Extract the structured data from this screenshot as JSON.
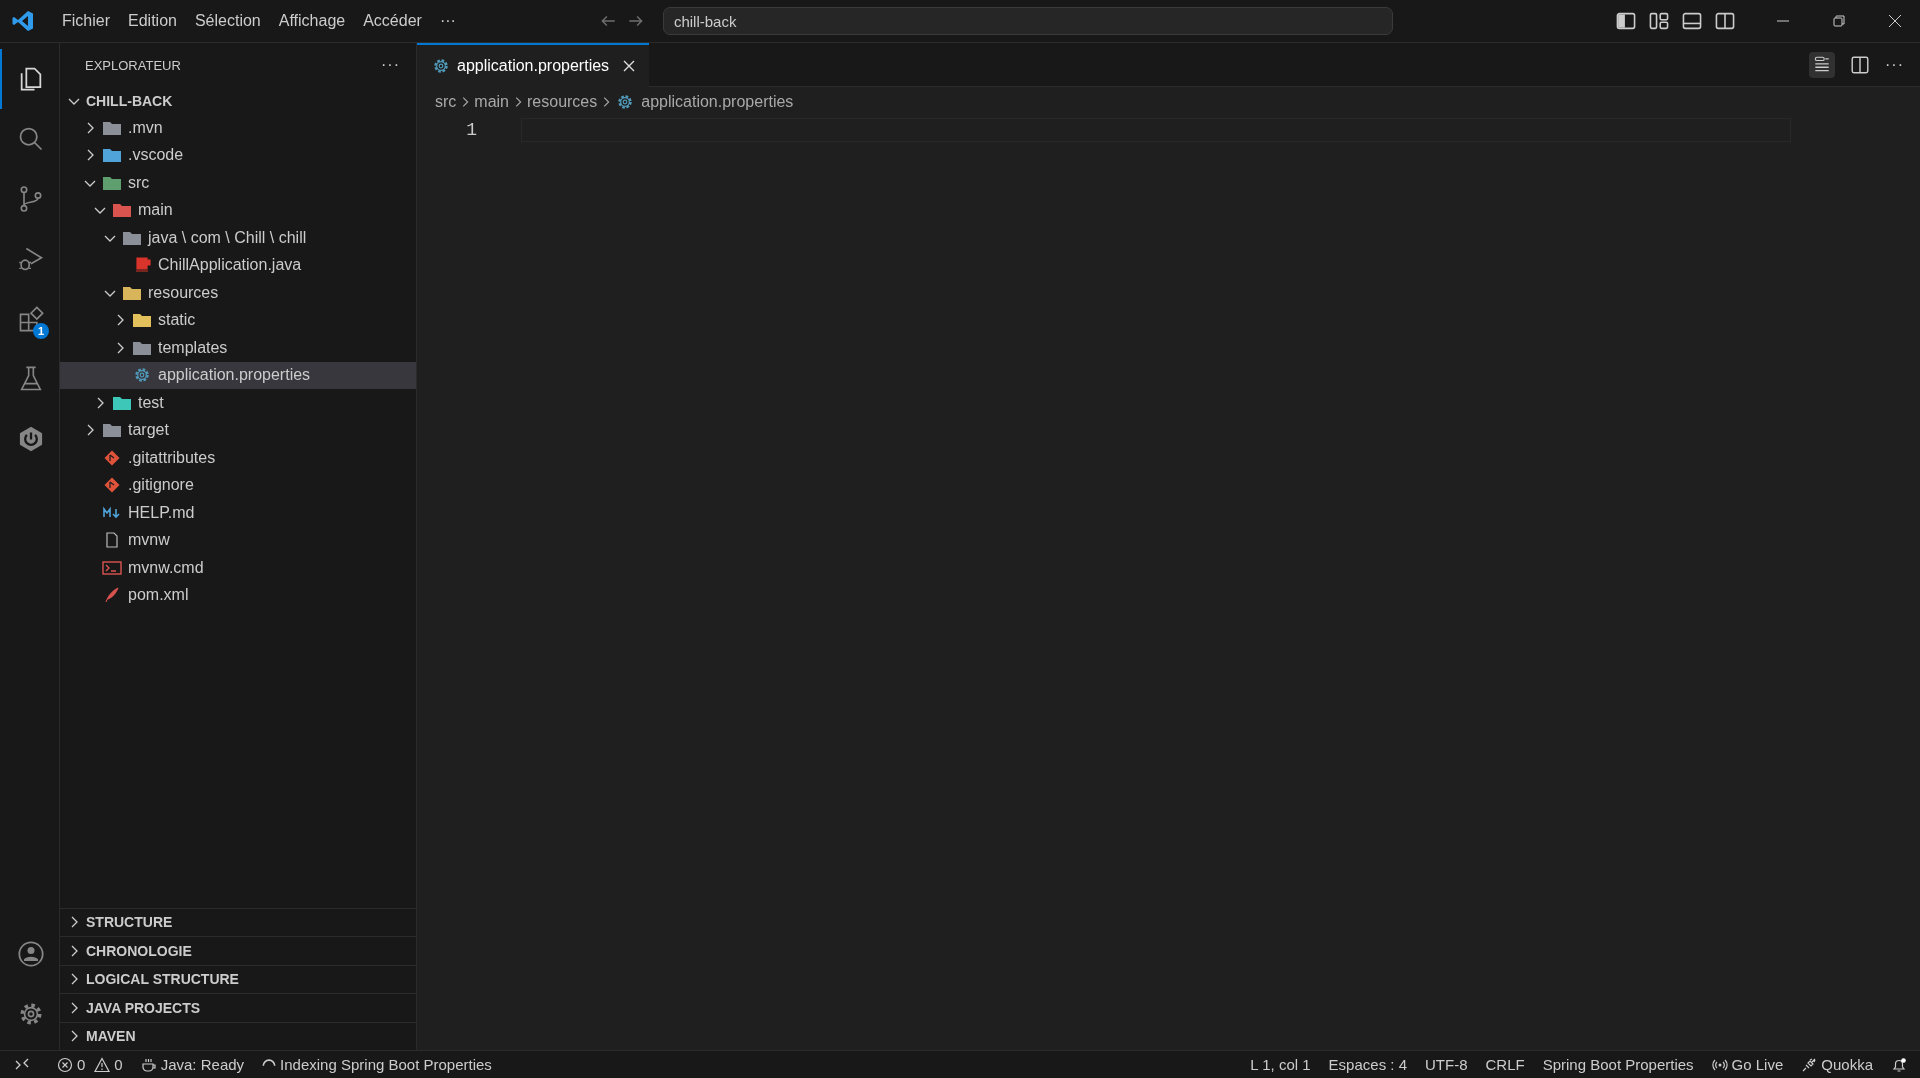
{
  "menu": [
    {
      "label": "Fichier"
    },
    {
      "label": "Edition"
    },
    {
      "label": "Sélection"
    },
    {
      "label": "Affichage"
    },
    {
      "label": "Accéder"
    },
    {
      "label": "···"
    }
  ],
  "search": {
    "value": "chill-back"
  },
  "activity_bar": {
    "items": [
      {
        "kind": "explorer",
        "selected": true
      },
      {
        "kind": "search",
        "selected": false
      },
      {
        "kind": "source-control",
        "selected": false
      },
      {
        "kind": "run-debug",
        "selected": false
      },
      {
        "kind": "extensions",
        "selected": false,
        "badge": "1"
      },
      {
        "kind": "testing",
        "selected": false
      },
      {
        "kind": "spring-boot",
        "selected": false
      }
    ],
    "bottom": [
      {
        "kind": "account"
      },
      {
        "kind": "settings"
      }
    ]
  },
  "sidebar": {
    "title": "EXPLORATEUR",
    "more": "···",
    "root": {
      "label": "CHILL-BACK",
      "expanded": true
    },
    "tree": [
      {
        "label": ".mvn",
        "kind": "folder-mvn",
        "expanded": false,
        "selected": false
      },
      {
        "label": ".vscode",
        "kind": "folder-vscode",
        "expanded": false,
        "selected": false
      },
      {
        "label": "src",
        "kind": "folder-src",
        "expanded": true,
        "selected": false,
        "children": [
          {
            "label": "main",
            "kind": "folder-main",
            "expanded": true,
            "selected": false,
            "children": [
              {
                "label": "java \\ com \\ Chill \\ chill",
                "kind": "folder-package",
                "expanded": true,
                "selected": false,
                "children": [
                  {
                    "label": "ChillApplication.java",
                    "kind": "java",
                    "selected": false
                  }
                ]
              },
              {
                "label": "resources",
                "kind": "folder-resources",
                "expanded": true,
                "selected": false,
                "children": [
                  {
                    "label": "static",
                    "kind": "folder-static",
                    "expanded": false,
                    "selected": false
                  },
                  {
                    "label": "templates",
                    "kind": "folder-templates",
                    "expanded": false,
                    "selected": false
                  },
                  {
                    "label": "application.properties",
                    "kind": "properties",
                    "selected": true
                  }
                ]
              }
            ]
          },
          {
            "label": "test",
            "kind": "folder-test",
            "expanded": false,
            "selected": false
          }
        ]
      },
      {
        "label": "target",
        "kind": "folder-target",
        "expanded": false,
        "selected": false
      },
      {
        "label": ".gitattributes",
        "kind": "git",
        "selected": false
      },
      {
        "label": ".gitignore",
        "kind": "git",
        "selected": false
      },
      {
        "label": "HELP.md",
        "kind": "markdown",
        "selected": false
      },
      {
        "label": "mvnw",
        "kind": "file",
        "selected": false
      },
      {
        "label": "mvnw.cmd",
        "kind": "cmd",
        "selected": false
      },
      {
        "label": "pom.xml",
        "kind": "xml",
        "selected": false
      }
    ],
    "panels": [
      {
        "label": "STRUCTURE",
        "expanded": false
      },
      {
        "label": "CHRONOLOGIE",
        "expanded": false
      },
      {
        "label": "LOGICAL STRUCTURE",
        "expanded": false
      },
      {
        "label": "JAVA PROJECTS",
        "expanded": false
      },
      {
        "label": "MAVEN",
        "expanded": false
      }
    ]
  },
  "editor": {
    "tabs": [
      {
        "label": "application.properties",
        "selected": true
      }
    ],
    "more": "···",
    "breadcrumbs": [
      {
        "label": "src",
        "kind": "plain"
      },
      {
        "label": "main",
        "kind": "plain"
      },
      {
        "label": "resources",
        "kind": "plain"
      },
      {
        "label": "application.properties",
        "kind": "properties"
      }
    ],
    "lines": [
      {
        "number": "1"
      }
    ]
  },
  "status_bar": {
    "left": [
      {
        "kind": "remote"
      },
      {
        "kind": "errors",
        "text": "0"
      },
      {
        "kind": "warnings",
        "text": "0"
      },
      {
        "kind": "java",
        "text": "Java: Ready"
      },
      {
        "kind": "indexing",
        "text": "Indexing Spring Boot Properties"
      }
    ],
    "right": [
      {
        "kind": "text",
        "text": "L 1, col 1"
      },
      {
        "kind": "text",
        "text": "Espaces : 4"
      },
      {
        "kind": "text",
        "text": "UTF-8"
      },
      {
        "kind": "text",
        "text": "CRLF"
      },
      {
        "kind": "text",
        "text": "Spring Boot Properties"
      },
      {
        "kind": "golive",
        "text": "Go Live"
      },
      {
        "kind": "quokka",
        "text": "Quokka"
      },
      {
        "kind": "bell"
      }
    ]
  }
}
